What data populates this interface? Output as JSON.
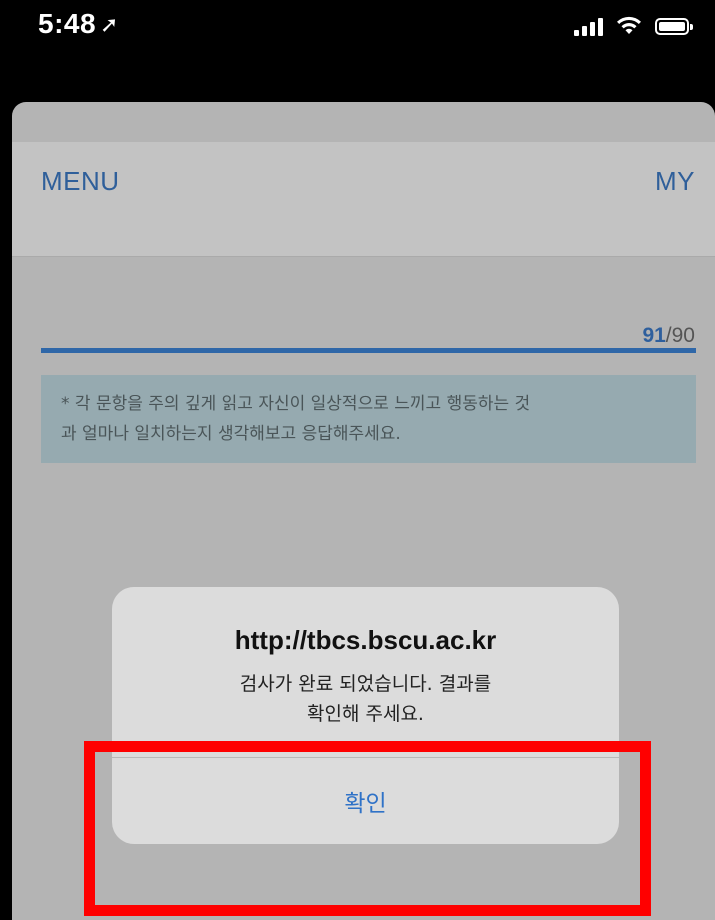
{
  "status_bar": {
    "time": "5:48",
    "location_icon": "location-arrow-icon",
    "signal_icon": "cellular-signal-icon",
    "wifi_icon": "wifi-icon",
    "battery_icon": "battery-icon"
  },
  "header": {
    "menu_label": "MENU",
    "my_label": "MY"
  },
  "progress": {
    "current": "91",
    "separator_total": "/90",
    "fraction": 1.0
  },
  "notice": {
    "line1": "* 각 문항을 주의 깊게 읽고 자신이 일상적으로 느끼고 행동하는 것",
    "line2": "과 얼마나 일치하는지 생각해보고 응답해주세요."
  },
  "alert": {
    "title": "http://tbcs.bscu.ac.kr",
    "message_line1": "검사가 완료 되었습니다. 결과를",
    "message_line2": "확인해 주세요.",
    "confirm_label": "확인"
  },
  "colors": {
    "accent": "#2f72c7",
    "highlight": "#ff0000",
    "progress": "#2f67a8"
  }
}
